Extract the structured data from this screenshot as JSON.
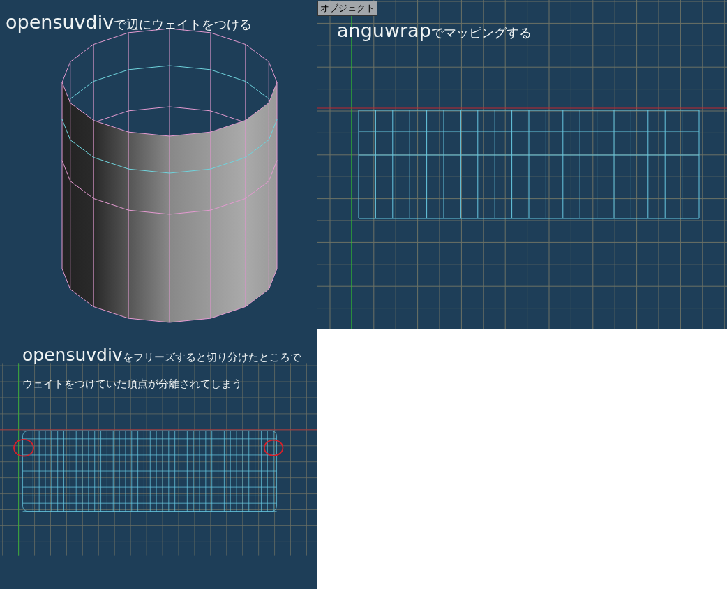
{
  "panels": [
    {
      "kind": "perspective",
      "caption": {
        "keyword": "opensuvdiv",
        "text": "で辺にウェイトをつける"
      }
    },
    {
      "kind": "uv",
      "button": "オブジェクト",
      "caption": {
        "keyword": "anguwrap",
        "text": "でマッピングする"
      }
    },
    {
      "kind": "uv_frozen",
      "caption": {
        "keyword": "opensuvdiv",
        "text": "をフリーズすると切り分けたところで"
      },
      "note": "ウェイトをつけていた頂点が分離されてしまう"
    }
  ]
}
